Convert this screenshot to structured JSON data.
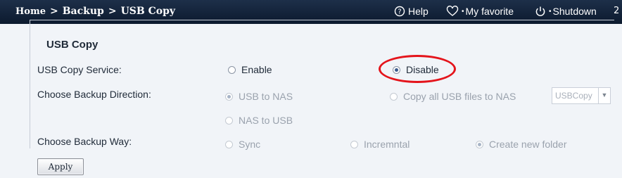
{
  "breadcrumb": {
    "home": "Home",
    "separator": ">",
    "section": "Backup",
    "page": "USB Copy"
  },
  "top_links": {
    "help": "Help",
    "favorite": "My favorite",
    "shutdown": "Shutdown"
  },
  "form": {
    "legend": "USB Copy",
    "service": {
      "label": "USB Copy Service:",
      "options": [
        "Enable",
        "Disable"
      ],
      "selected": "Disable"
    },
    "direction": {
      "label": "Choose Backup Direction:",
      "options": [
        "USB to NAS",
        "Copy all USB files to NAS",
        "NAS to USB"
      ],
      "selected": "USB to NAS",
      "folder_select": "USBCopy"
    },
    "way": {
      "label": "Choose Backup Way:",
      "options": [
        "Sync",
        "Incremntal",
        "Create new folder"
      ],
      "selected": "Create new folder"
    },
    "apply_label": "Apply"
  },
  "colors": {
    "topbar": "#0c1a2e",
    "highlight_ring": "#e4141b",
    "disabled_text": "#9aa2ad"
  },
  "icons": [
    "help-icon",
    "heart-icon",
    "power-icon",
    "chevron-down-icon"
  ]
}
